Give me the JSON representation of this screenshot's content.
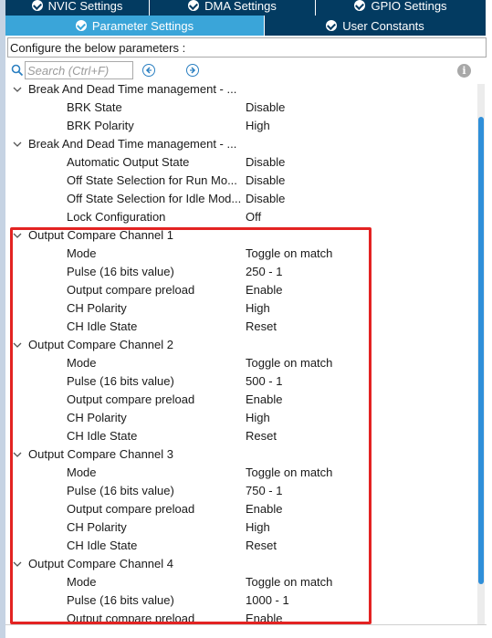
{
  "tabs_top": [
    {
      "label": "NVIC Settings"
    },
    {
      "label": "DMA Settings"
    },
    {
      "label": "GPIO Settings"
    }
  ],
  "tabs_second": [
    {
      "label": "Parameter Settings",
      "active": true
    },
    {
      "label": "User Constants",
      "active": false
    }
  ],
  "configure_text": "Configure the below parameters :",
  "search": {
    "placeholder": "Search (Ctrl+F)"
  },
  "tree": [
    {
      "type": "group",
      "label": "Break And Dead Time management - ..."
    },
    {
      "type": "param",
      "label": "BRK State",
      "value": "Disable"
    },
    {
      "type": "param",
      "label": "BRK Polarity",
      "value": "High"
    },
    {
      "type": "group",
      "label": "Break And Dead Time management - ..."
    },
    {
      "type": "param",
      "label": "Automatic Output State",
      "value": "Disable"
    },
    {
      "type": "param",
      "label": "Off State Selection for Run Mo...",
      "value": "Disable"
    },
    {
      "type": "param",
      "label": "Off State Selection for Idle Mod...",
      "value": "Disable"
    },
    {
      "type": "param",
      "label": "Lock Configuration",
      "value": "Off"
    },
    {
      "type": "group",
      "label": "Output Compare Channel 1"
    },
    {
      "type": "param",
      "label": "Mode",
      "value": "Toggle on match"
    },
    {
      "type": "param",
      "label": "Pulse (16 bits value)",
      "value": "250 - 1"
    },
    {
      "type": "param",
      "label": "Output compare preload",
      "value": "Enable"
    },
    {
      "type": "param",
      "label": "CH Polarity",
      "value": "High"
    },
    {
      "type": "param",
      "label": "CH Idle State",
      "value": "Reset"
    },
    {
      "type": "group",
      "label": "Output Compare Channel 2"
    },
    {
      "type": "param",
      "label": "Mode",
      "value": "Toggle on match"
    },
    {
      "type": "param",
      "label": "Pulse (16 bits value)",
      "value": "500 - 1"
    },
    {
      "type": "param",
      "label": "Output compare preload",
      "value": "Enable"
    },
    {
      "type": "param",
      "label": "CH Polarity",
      "value": "High"
    },
    {
      "type": "param",
      "label": "CH Idle State",
      "value": "Reset"
    },
    {
      "type": "group",
      "label": "Output Compare Channel 3"
    },
    {
      "type": "param",
      "label": "Mode",
      "value": "Toggle on match"
    },
    {
      "type": "param",
      "label": "Pulse (16 bits value)",
      "value": "750 - 1"
    },
    {
      "type": "param",
      "label": "Output compare preload",
      "value": "Enable"
    },
    {
      "type": "param",
      "label": "CH Polarity",
      "value": "High"
    },
    {
      "type": "param",
      "label": "CH Idle State",
      "value": "Reset"
    },
    {
      "type": "group",
      "label": "Output Compare Channel 4"
    },
    {
      "type": "param",
      "label": "Mode",
      "value": "Toggle on match"
    },
    {
      "type": "param",
      "label": "Pulse (16 bits value)",
      "value": "1000 - 1"
    },
    {
      "type": "param",
      "label": "Output compare preload",
      "value": "Enable"
    }
  ],
  "colors": {
    "tab_dark": "#033b61",
    "tab_active": "#3aa5d9",
    "highlight": "#e32322",
    "scroll_thumb": "#2f8fd9"
  }
}
